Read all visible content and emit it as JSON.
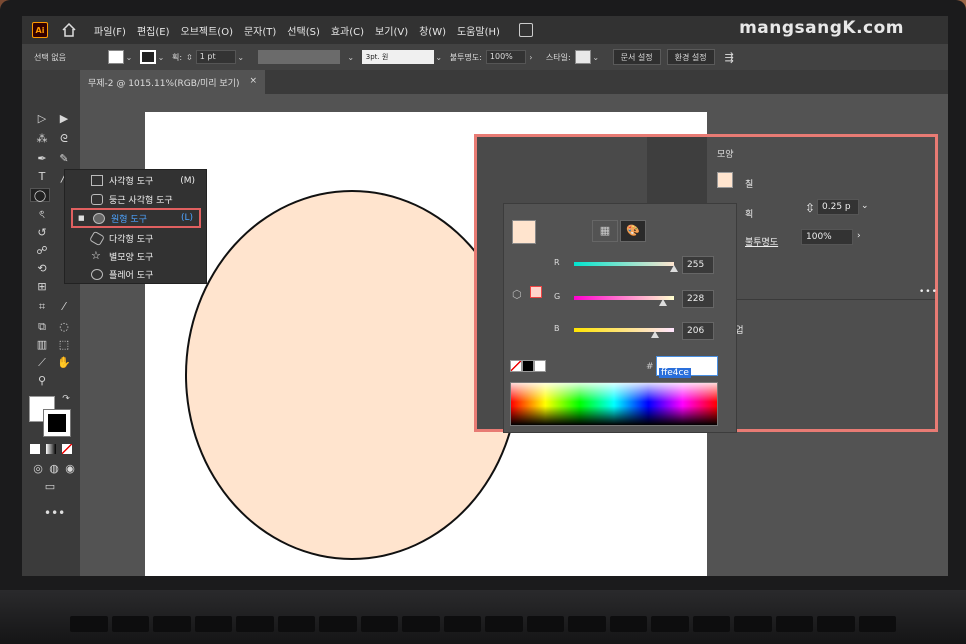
{
  "watermark": "mangsangK.com",
  "app": {
    "logo": "Ai"
  },
  "menu": {
    "items": [
      "파일(F)",
      "편집(E)",
      "오브젝트(O)",
      "문자(T)",
      "선택(S)",
      "효과(C)",
      "보기(V)",
      "창(W)",
      "도움말(H)"
    ]
  },
  "control": {
    "selection_label": "선택 없음",
    "stroke_label": "획:",
    "stroke_weight": "1 pt",
    "brush_value": "3pt. 원",
    "opacity_label": "불투명도:",
    "opacity_value": "100%",
    "style_label": "스타일:",
    "doc_setup": "문서 설정",
    "preferences": "환경 설정"
  },
  "tab": {
    "title": "무제-2 @ 1015.11%(RGB/미리 보기)",
    "close": "×"
  },
  "flyout": {
    "items": [
      {
        "label": "사각형 도구",
        "key": "(M)",
        "icon": "rectangle-icon"
      },
      {
        "label": "둥근 사각형 도구",
        "key": "",
        "icon": "rounded-rectangle-icon"
      },
      {
        "label": "원형 도구",
        "key": "(L)",
        "icon": "ellipse-icon"
      },
      {
        "label": "다각형 도구",
        "key": "",
        "icon": "polygon-icon"
      },
      {
        "label": "별모양 도구",
        "key": "",
        "icon": "star-icon"
      },
      {
        "label": "플레어 도구",
        "key": "",
        "icon": "flare-icon"
      }
    ]
  },
  "properties": {
    "title": "모양",
    "fill_label": "칠",
    "stroke_label": "획",
    "stroke_value": "0.25 p",
    "opacity_label": "불투명도",
    "opacity_value": "100%",
    "more": "•••",
    "quick_actions": "작업"
  },
  "color_picker": {
    "channels": [
      {
        "name": "R",
        "value": 255,
        "max": 255,
        "track": "linear-gradient(90deg,#00e4ce,#ffe4ce)"
      },
      {
        "name": "G",
        "value": 228,
        "max": 255,
        "track": "linear-gradient(90deg,#ff00ce,#ffffce)"
      },
      {
        "name": "B",
        "value": 206,
        "max": 255,
        "track": "linear-gradient(90deg,#ffe400,#ffe4ff)"
      }
    ],
    "hash": "#",
    "hex": "ffe4ce",
    "swatch_color": "#ffe4ce"
  },
  "colors": {
    "fill": "#ffe4ce",
    "highlight": "#e87b74",
    "accent": "#4da3ff"
  }
}
